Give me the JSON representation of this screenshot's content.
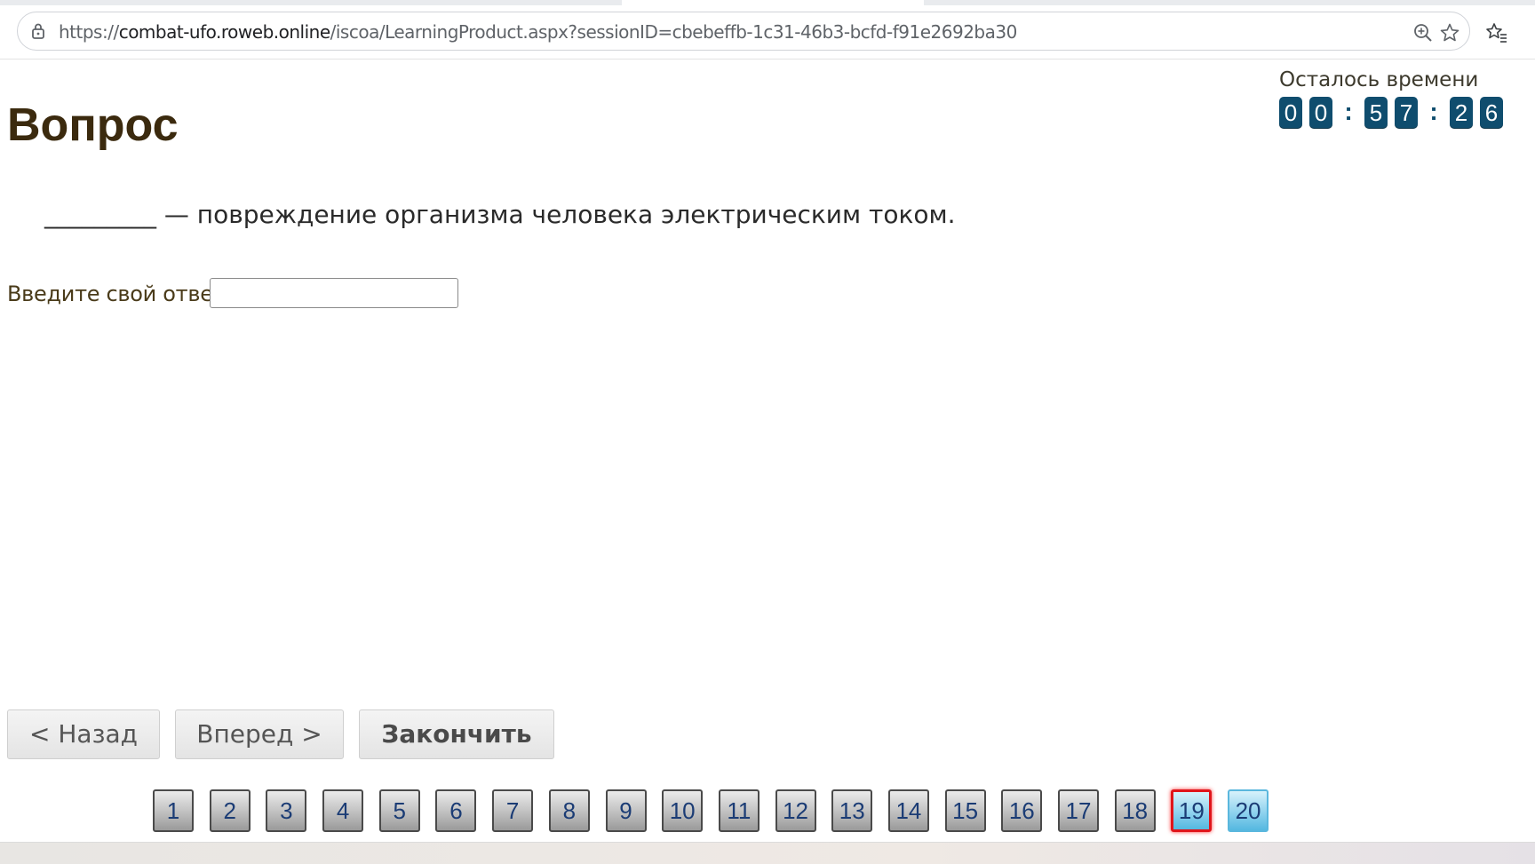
{
  "browser": {
    "url_prefix": "https://",
    "url_host": "combat-ufo.roweb.online",
    "url_path": "/iscoa/LearningProduct.aspx?sessionID=cbebeffb-1c31-46b3-bcfd-f91e2692ba30",
    "icons": [
      "lock-icon",
      "zoom-icon",
      "bookmark-star-icon",
      "favorites-icon"
    ]
  },
  "page": {
    "title": "Вопрос",
    "timer_label": "Осталось времени",
    "timer": {
      "h1": "0",
      "h2": "0",
      "sep1": ":",
      "m1": "5",
      "m2": "7",
      "sep2": ":",
      "s1": "2",
      "s2": "6"
    },
    "question": "_________ — повреждение организма человека электрическим током.",
    "answer_label": "Введите свой ответ",
    "answer_value": ""
  },
  "buttons": {
    "back": "< Назад",
    "forward": "Вперед >",
    "finish": "Закончить"
  },
  "pager": {
    "items": [
      "1",
      "2",
      "3",
      "4",
      "5",
      "6",
      "7",
      "8",
      "9",
      "10",
      "11",
      "12",
      "13",
      "14",
      "15",
      "16",
      "17",
      "18",
      "19",
      "20"
    ],
    "current": "19"
  },
  "colors": {
    "timer_digit_bg": "#0f4d6e",
    "current_page_border": "#e0151b",
    "page_button_text": "#1b3c75",
    "title": "#3b2a0e"
  }
}
